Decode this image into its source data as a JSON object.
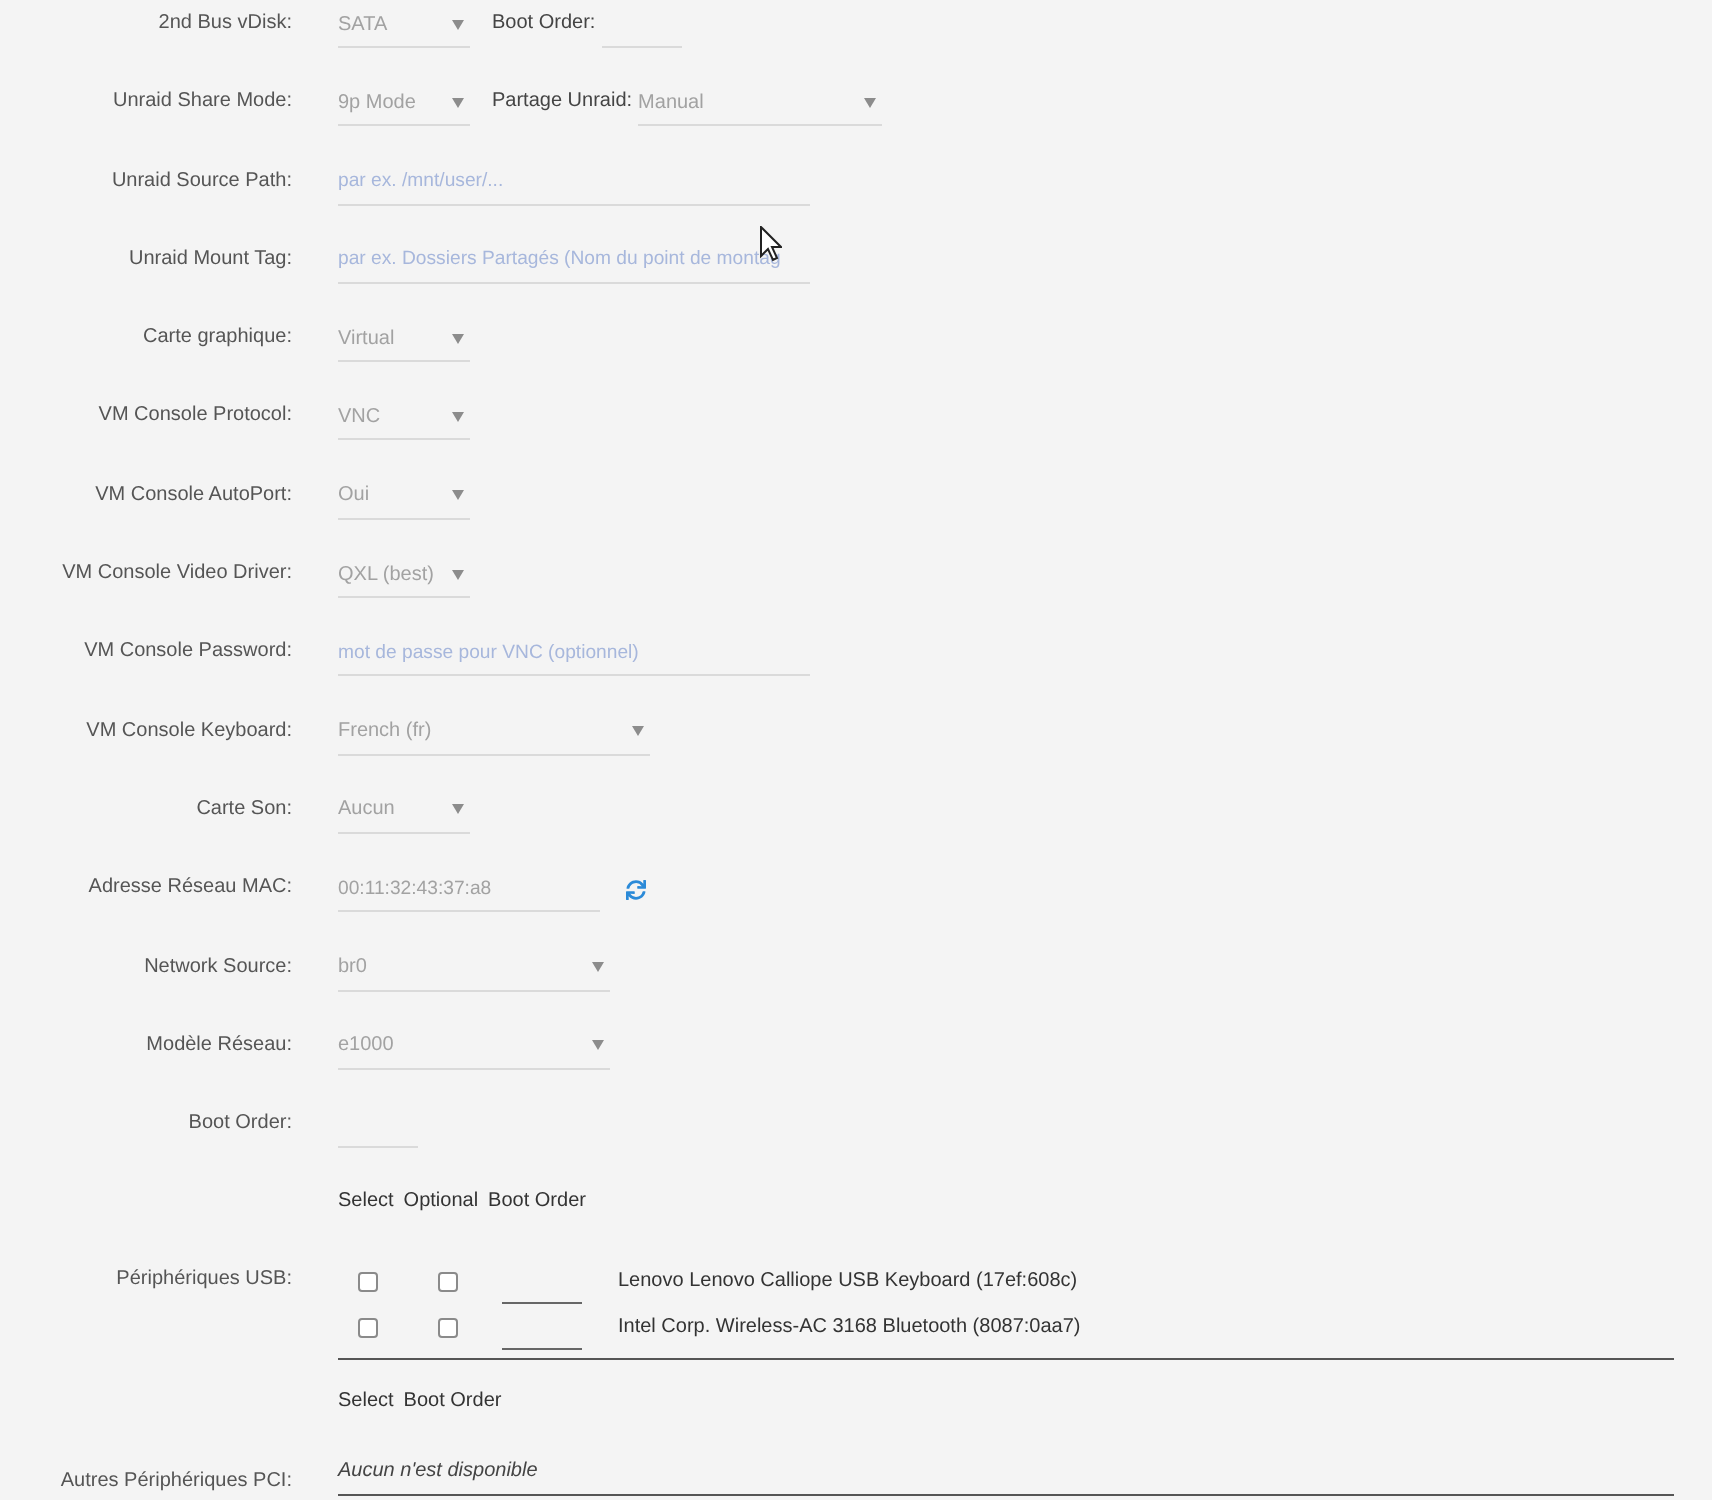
{
  "form_rows": [
    {
      "kind": "select",
      "label": "2nd Bus vDisk:",
      "value": "SATA",
      "inline": {
        "kind": "input",
        "label": "Boot Order:"
      }
    },
    {
      "kind": "select",
      "label": "Unraid Share Mode:",
      "value": "9p Mode",
      "inline": {
        "kind": "select",
        "label": "Partage Unraid:",
        "value": "Manual"
      }
    },
    {
      "kind": "input",
      "label": "Unraid Source Path:",
      "placeholder": "par ex. /mnt/user/..."
    },
    {
      "kind": "input",
      "label": "Unraid Mount Tag:",
      "placeholder": "par ex. Dossiers Partagés (Nom du point de montag"
    },
    {
      "kind": "select",
      "label": "Carte graphique:",
      "value": "Virtual"
    },
    {
      "kind": "select",
      "label": "VM Console Protocol:",
      "value": "VNC"
    },
    {
      "kind": "select",
      "label": "VM Console AutoPort:",
      "value": "Oui"
    },
    {
      "kind": "select",
      "label": "VM Console Video Driver:",
      "value": "QXL (best)"
    },
    {
      "kind": "input",
      "label": "VM Console Password:",
      "placeholder": "mot de passe pour VNC (optionnel)"
    },
    {
      "kind": "select",
      "label": "VM Console Keyboard:",
      "value": "French (fr)"
    },
    {
      "kind": "select",
      "label": "Carte Son:",
      "value": "Aucun"
    },
    {
      "kind": "input",
      "label": "Adresse Réseau MAC:",
      "value": "00:11:32:43:37:a8",
      "refresh_button": true
    },
    {
      "kind": "select",
      "label": "Network Source:",
      "value": "br0"
    },
    {
      "kind": "select",
      "label": "Modèle Réseau:",
      "value": "e1000"
    },
    {
      "kind": "input",
      "label": "Boot Order:"
    }
  ],
  "usb_devices": {
    "label": "Périphériques USB:",
    "columns": [
      "Select",
      "Optional",
      "Boot Order"
    ],
    "devices": [
      {
        "name": "Lenovo Lenovo Calliope USB Keyboard (17ef:608c)",
        "selected": false,
        "optional": false
      },
      {
        "name": "Intel Corp. Wireless-AC 3168 Bluetooth (8087:0aa7)",
        "selected": false,
        "optional": false
      }
    ]
  },
  "pci_devices": {
    "label": "Autres Périphériques PCI:",
    "columns": [
      "Select",
      "Boot Order"
    ],
    "empty_text": "Aucun n'est disponible"
  }
}
